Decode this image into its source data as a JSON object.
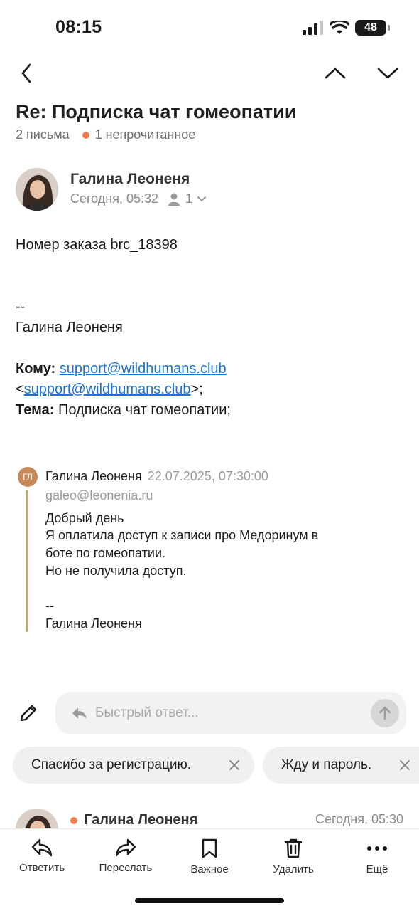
{
  "status_bar": {
    "time": "08:15",
    "battery": "48"
  },
  "header": {
    "subject": "Re: Подписка чат гомеопатии",
    "count": "2 письма",
    "unread": "1 непрочитанное"
  },
  "message": {
    "sender": "Галина Леоненя",
    "date": "Сегодня, 05:32",
    "recipients": "1",
    "order_line": "Номер заказа brc_18398",
    "sig_dash": "--",
    "sig_name": "Галина Леоненя",
    "to_label": "Кому:",
    "to_email": "support@wildhumans.club",
    "to_open": "<",
    "to_email2": "support@wildhumans.club",
    "to_close": ">;",
    "subject_label": "Тема:",
    "subject_value": "Подписка чат гомеопатии;"
  },
  "quoted": {
    "initials": "ГЛ",
    "sender": "Галина Леоненя",
    "date": "22.07.2025, 07:30:00",
    "email": "galeo@leonenia.ru",
    "lines": [
      "Добрый день",
      "Я оплатила доступ к записи про Медоринум в",
      "боте по гомеопатии.",
      "Но не получила доступ."
    ],
    "sig_dash": "--",
    "sig_name": "Галина Леоненя"
  },
  "quick_reply": {
    "placeholder": "Быстрый ответ...",
    "chips": [
      "Спасибо за регистрацию.",
      "Жду и пароль."
    ]
  },
  "next_message": {
    "sender": "Галина Леоненя",
    "time": "Сегодня, 05:30"
  },
  "bottom_bar": {
    "reply": "Ответить",
    "forward": "Переслать",
    "important": "Важное",
    "delete": "Удалить",
    "more": "Ещё"
  },
  "colors": {
    "accent": "#1a73d9",
    "unread_dot": "#f47b4d",
    "quote_bar": "#d1a070"
  }
}
